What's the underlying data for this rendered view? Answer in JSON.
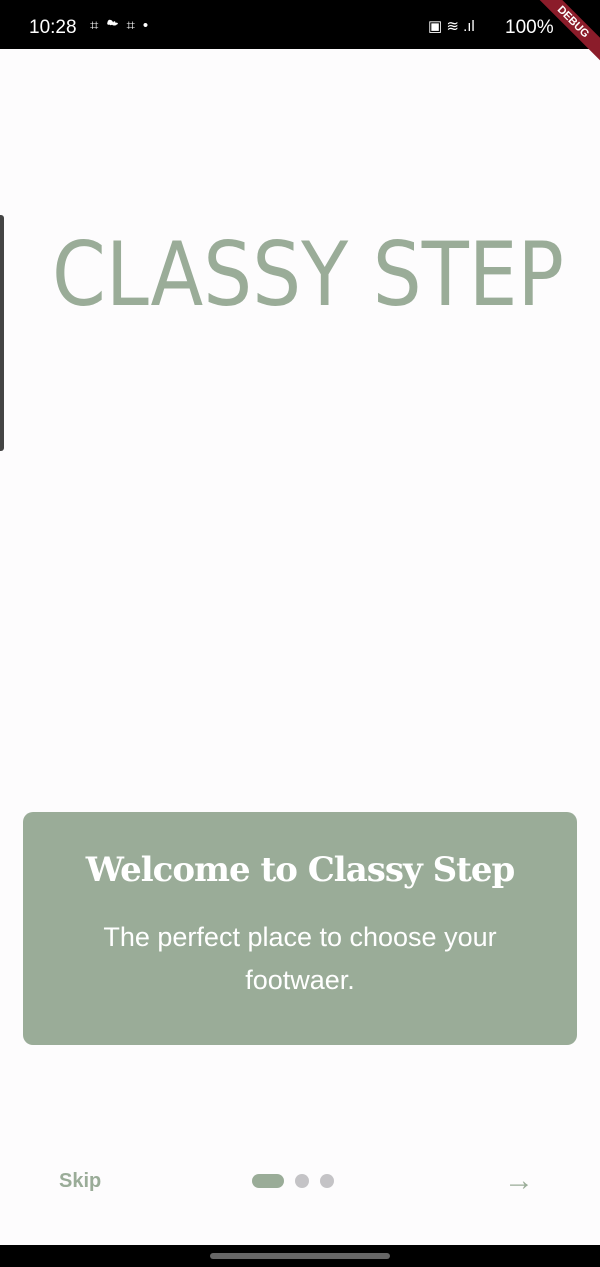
{
  "status_bar": {
    "time": "10:28",
    "left_icons": "⌗☁⌗•",
    "right_icons": "▣ ≋ .ıl",
    "battery": "100%",
    "debug_banner": "DEBUG"
  },
  "logo": {
    "text": "CLASSY STEP"
  },
  "card": {
    "title": "Welcome to Classy Step",
    "subtitle": "The perfect place to choose your footwaer."
  },
  "footer": {
    "skip_label": "Skip",
    "next_icon": "→",
    "page_index": 0,
    "page_count": 3
  },
  "colors": {
    "accent": "#9aac98",
    "inactive_dot": "#c4c3c6"
  }
}
